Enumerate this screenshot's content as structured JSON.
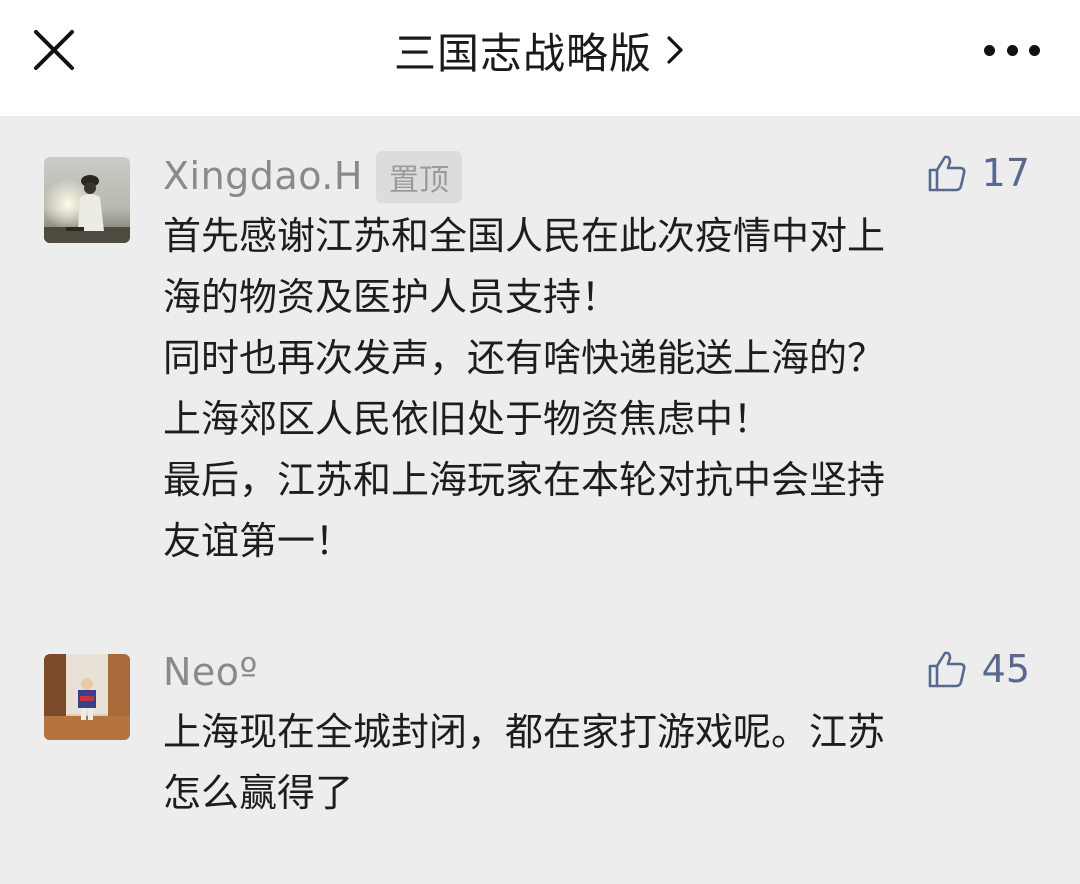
{
  "header": {
    "title": "三国志战略版",
    "close_icon": "close-icon",
    "chevron_icon": "chevron-right-icon",
    "more_icon": "more-horizontal-icon"
  },
  "comments": [
    {
      "username": "Xingdao.H",
      "badge": "置顶",
      "likes": "17",
      "lines": [
        "首先感谢江苏和全国人民在此次疫情中对上",
        "海的物资及医护人员支持！",
        "同时也再次发声，还有啥快递能送上海的？",
        "上海郊区人民依旧处于物资焦虑中！",
        "最后，江苏和上海玩家在本轮对抗中会坚持",
        "友谊第一！"
      ]
    },
    {
      "username": "Neoº",
      "likes": "45",
      "lines": [
        "上海现在全城封闭，都在家打游戏呢。江苏",
        "怎么赢得了"
      ]
    }
  ],
  "colors": {
    "background": "#ededed",
    "header_bg": "#ffffff",
    "like_blue": "#57698f",
    "username_gray": "#8a8a8a"
  }
}
